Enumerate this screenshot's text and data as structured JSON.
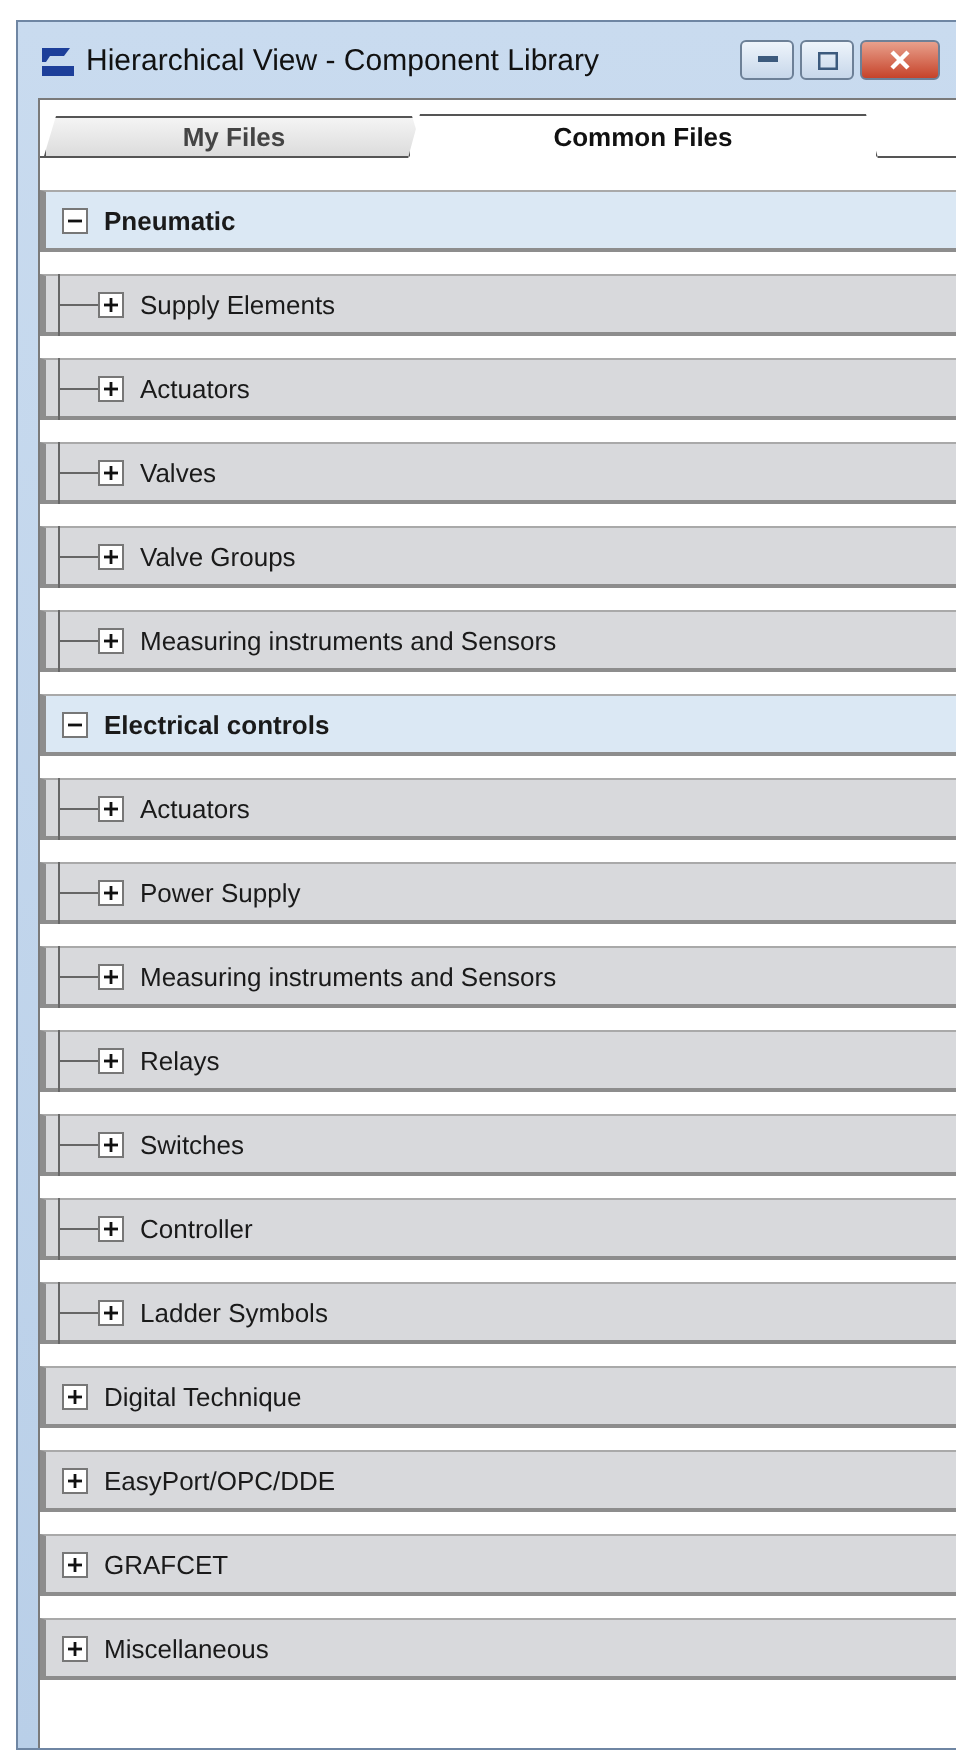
{
  "window": {
    "title": "Hierarchical View - Component Library"
  },
  "tabs": [
    {
      "label": "My Files",
      "selected": false
    },
    {
      "label": "Common Files",
      "selected": true
    }
  ],
  "tree": [
    {
      "label": "Pneumatic",
      "expanded": true,
      "children": [
        {
          "label": "Supply Elements",
          "expanded": false
        },
        {
          "label": "Actuators",
          "expanded": false
        },
        {
          "label": "Valves",
          "expanded": false
        },
        {
          "label": "Valve Groups",
          "expanded": false
        },
        {
          "label": "Measuring instruments and Sensors",
          "expanded": false
        }
      ]
    },
    {
      "label": "Electrical controls",
      "expanded": true,
      "children": [
        {
          "label": "Actuators",
          "expanded": false
        },
        {
          "label": "Power Supply",
          "expanded": false
        },
        {
          "label": "Measuring instruments and Sensors",
          "expanded": false
        },
        {
          "label": "Relays",
          "expanded": false
        },
        {
          "label": "Switches",
          "expanded": false
        },
        {
          "label": "Controller",
          "expanded": false
        },
        {
          "label": "Ladder Symbols",
          "expanded": false
        }
      ]
    },
    {
      "label": "Digital Technique",
      "expanded": false
    },
    {
      "label": "EasyPort/OPC/DDE",
      "expanded": false
    },
    {
      "label": "GRAFCET",
      "expanded": false
    },
    {
      "label": "Miscellaneous",
      "expanded": false
    }
  ]
}
